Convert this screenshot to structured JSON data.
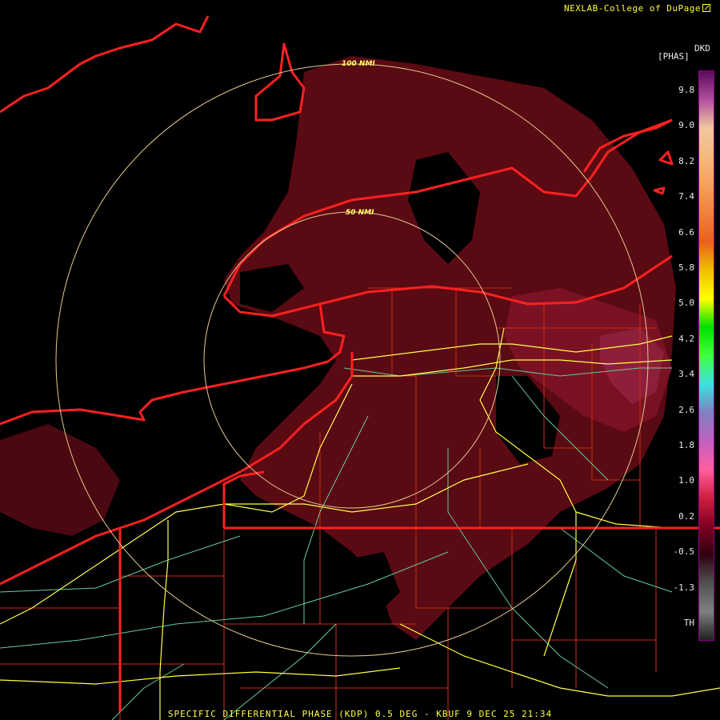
{
  "credit": "NEXLAB-College of DuPage",
  "legend": {
    "product": "DKD",
    "units": "[PHAS]",
    "ticks": [
      "9.8",
      "9.0",
      "8.2",
      "7.4",
      "6.6",
      "5.8",
      "5.0",
      "4.2",
      "3.4",
      "2.6",
      "1.8",
      "1.0",
      "0.2",
      "-0.5",
      "-1.3",
      "TH"
    ]
  },
  "range_rings": {
    "outer": "100 NMI",
    "inner": "50 NMI"
  },
  "footer": "SPECIFIC DIFFERENTIAL PHASE (KDP) 0.5 DEG - KBUF 9 DEC 25 21:34",
  "colors": {
    "background": "#000000",
    "echo": "#5a0a12",
    "echo_strong": "#7a1224",
    "echo_peak": "#8e1f3a",
    "state_border": "#ff2020",
    "county_line": "#cc2a1a",
    "interstate": "#ffff44",
    "highway": "#66cc99",
    "range_ring": "#e6c890",
    "label_yellow": "#ffff33"
  },
  "colorbar_scale": [
    "#5a0a5a",
    "#b24fa0",
    "#f0c8a0",
    "#f5b880",
    "#f5a060",
    "#f08040",
    "#e86020",
    "#f0c000",
    "#ffff00",
    "#00e000",
    "#40ff40",
    "#40e0e0",
    "#8080c0",
    "#c060c0",
    "#ff60a0",
    "#d02040",
    "#800020",
    "#300010",
    "#505050",
    "#808080",
    "#202020"
  ]
}
